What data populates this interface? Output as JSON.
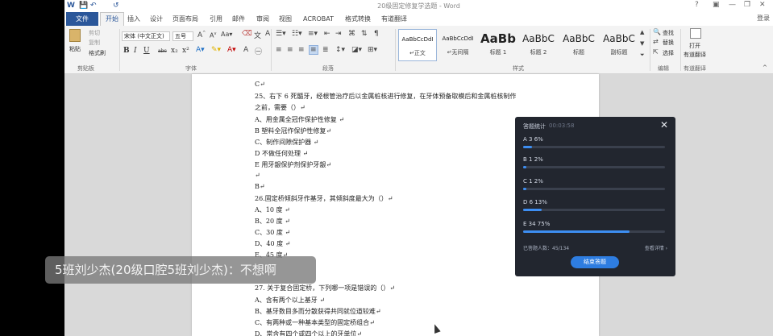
{
  "word": {
    "title": "20级固定修复学选题 - Word",
    "quick_access": [
      "W",
      "💾",
      "↶",
      "↺"
    ],
    "window_controls": [
      "?",
      "▣",
      "—",
      "❐",
      "✕"
    ],
    "login": "登录",
    "tabs": {
      "file": "文件",
      "home": "开始",
      "insert": "插入",
      "design": "设计",
      "layout": "页面布局",
      "references": "引用",
      "mailings": "邮件",
      "review": "审阅",
      "view": "视图",
      "acrobat": "ACROBAT",
      "format_convert": "格式转换",
      "youdao": "有道翻译"
    },
    "ribbon": {
      "clipboard": {
        "paste": "粘贴",
        "cut": "剪切",
        "copy": "复制",
        "format_painter": "格式刷",
        "label": "剪贴板"
      },
      "font": {
        "font_name": "宋体 (中文正文)",
        "font_size": "五号",
        "label": "字体",
        "buttons": [
          "B",
          "I",
          "U",
          "abc",
          "x₂",
          "x²"
        ]
      },
      "paragraph": {
        "label": "段落"
      },
      "styles": {
        "label": "样式",
        "items": [
          {
            "sample": "AaBbCcDdI",
            "name": "↵正文"
          },
          {
            "sample": "AaBbCcDdI",
            "name": "↵无间隔"
          },
          {
            "sample": "AaBb",
            "name": "标题 1"
          },
          {
            "sample": "AaBbC",
            "name": "标题 2"
          },
          {
            "sample": "AaBbC",
            "name": "标题"
          },
          {
            "sample": "AaBbC",
            "name": "副标题"
          }
        ]
      },
      "editing": {
        "find": "查找",
        "replace": "替换",
        "select": "选择",
        "label": "编辑"
      },
      "translate": {
        "open": "打开",
        "youdao": "有道翻译",
        "label": "有道翻译"
      }
    }
  },
  "document": {
    "lines": [
      "C↵",
      "25、右下 6 死髓牙，经根管治疗后以金属桩核进行修复，在牙体预备取模后和金属桩核制作",
      "之前，需要（）↵",
      "A、用金属全冠作保护性修复      ↵",
      "B  塑料全冠作保护性修复↵",
      "C、制作间隙保护器    ↵",
      "D 不做任何处理      ↵",
      "E 用牙龈保护剂保护牙龈↵",
      "↵",
      "B↵",
      "26.固定桥倾斜牙作基牙，其倾斜度最大为（）↵",
      "A、10 度    ↵",
      "B、20 度    ↵",
      "C、30 度    ↵",
      "D、40 度    ↵",
      "E、45 度↵",
      "",
      "27. 关于复合固定桥，下列哪一项是错误的（）↵",
      "A、含有两个以上基牙      ↵",
      "B、基牙数目多而分散获得共同就位道较难↵",
      "C、有两种或一种基本类型的固定桥组合↵",
      "D、常含有四个或四个以上的牙单位↵"
    ]
  },
  "vote_panel": {
    "title": "答题统计",
    "timer": "00:03:58",
    "close": "✕",
    "options": [
      {
        "label": "A  3  6%",
        "fraction": 0.06
      },
      {
        "label": "B  1  2%",
        "fraction": 0.02
      },
      {
        "label": "C  1  2%",
        "fraction": 0.02
      },
      {
        "label": "D  6  13%",
        "fraction": 0.13
      },
      {
        "label": "E  34  75%",
        "fraction": 0.75
      }
    ],
    "answered": "已答题人数：45/134",
    "detail": "查看详情 ›",
    "end_button": "结束答题"
  },
  "caption": "5班刘少杰(20级口腔5班刘少杰)：不想啊"
}
